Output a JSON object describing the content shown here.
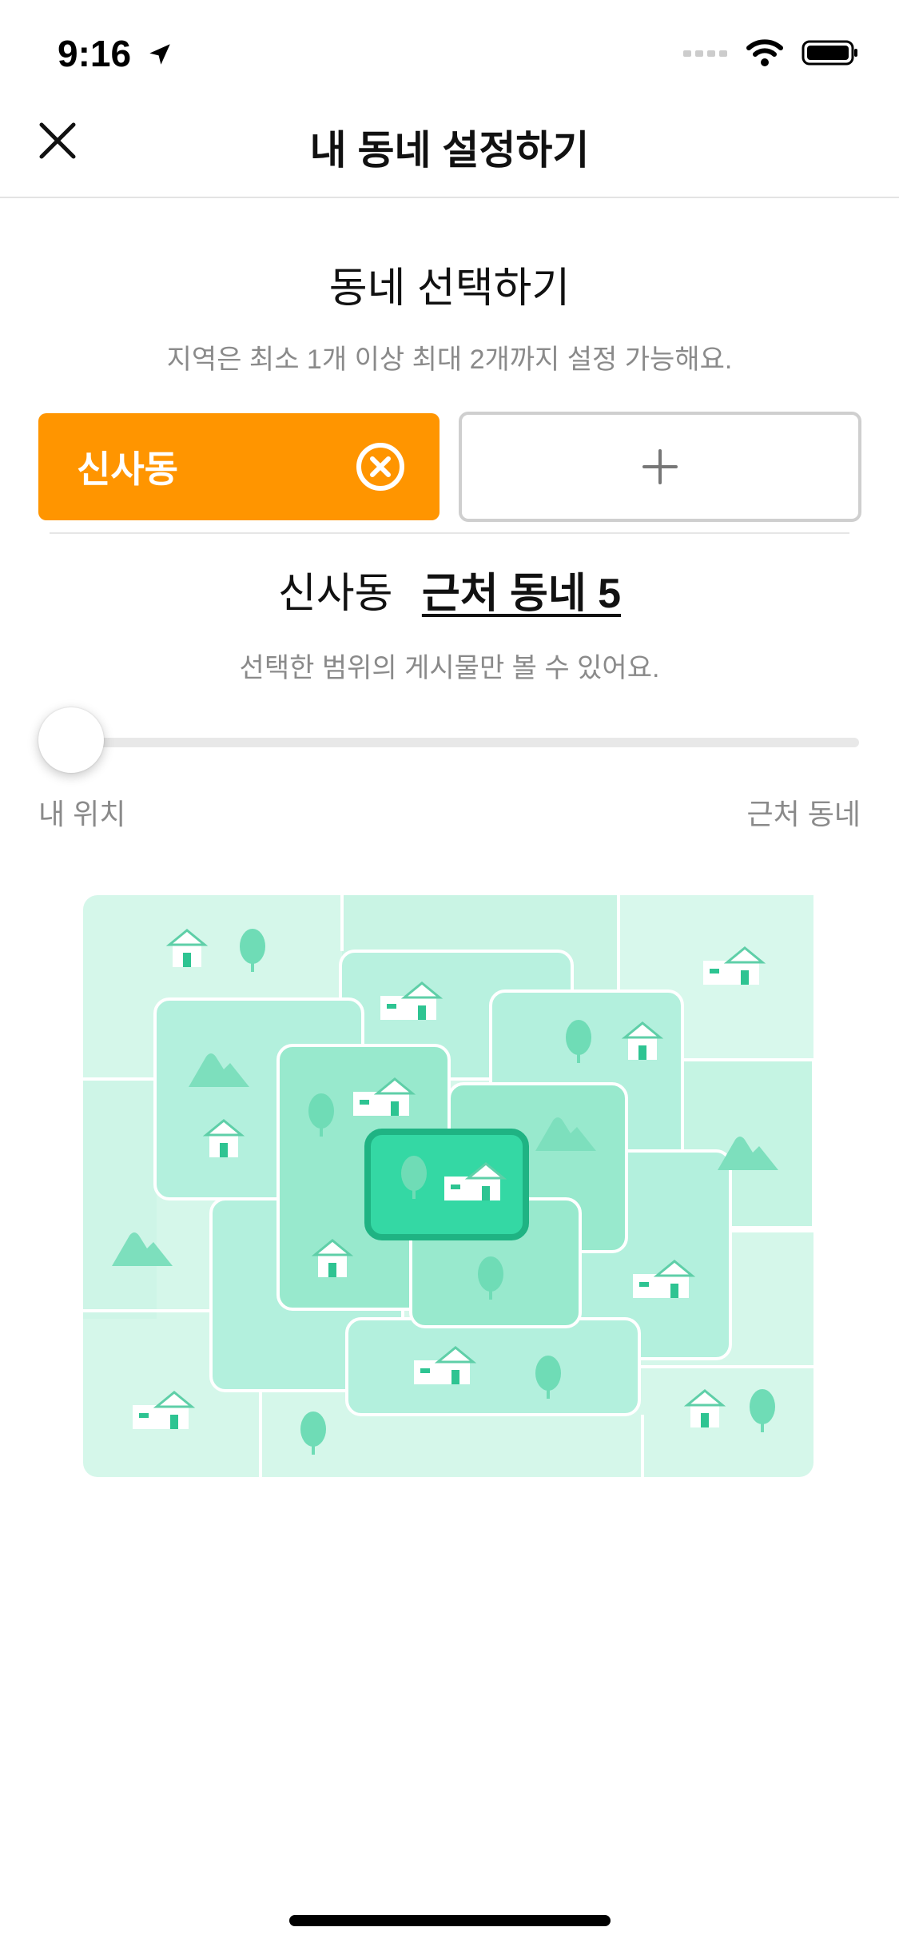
{
  "status_bar": {
    "time": "9:16"
  },
  "header": {
    "title": "내 동네 설정하기"
  },
  "section": {
    "title": "동네 선택하기",
    "description": "지역은 최소 1개 이상 최대 2개까지 설정 가능해요."
  },
  "chips": {
    "selected_label": "신사동",
    "add_symbol": "+"
  },
  "range": {
    "place": "신사동",
    "link_label": "근처 동네 5",
    "description": "선택한 범위의 게시물만 볼 수 있어요."
  },
  "slider": {
    "label_left": "내 위치",
    "label_right": "근처 동네",
    "value_fraction": 0
  },
  "colors": {
    "accent": "#ff9500",
    "map_light": "#d5f7ea",
    "map_mid": "#b3f0dd",
    "map_dark": "#8fe6c8",
    "map_center": "#34d8a4"
  },
  "icons": {
    "close": "close-icon",
    "location": "location-arrow-icon",
    "remove": "close-circle-icon",
    "add": "plus-icon"
  }
}
